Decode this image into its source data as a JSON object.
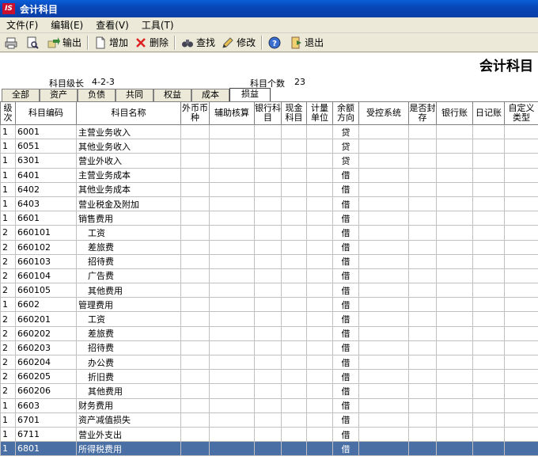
{
  "window": {
    "title": "会计科目",
    "logo_text": "IS"
  },
  "menu": [
    "文件(F)",
    "编辑(E)",
    "查看(V)",
    "工具(T)"
  ],
  "toolbar": {
    "export": "输出",
    "add": "增加",
    "delete": "删除",
    "find": "查找",
    "modify": "修改",
    "exit": "退出"
  },
  "page": {
    "heading": "会计科目",
    "level_label": "科目级长",
    "level_value": "4-2-3",
    "count_label": "科目个数",
    "count_value": "23"
  },
  "tabs": [
    "全部",
    "资产",
    "负债",
    "共同",
    "权益",
    "成本",
    "损益"
  ],
  "active_tab": "损益",
  "columns": [
    "级次",
    "科目编码",
    "科目名称",
    "外币币种",
    "辅助核算",
    "银行科目",
    "现金科目",
    "计量单位",
    "余额方向",
    "受控系统",
    "是否封存",
    "银行账",
    "日记账",
    "自定义类型"
  ],
  "rows": [
    {
      "level": "1",
      "code": "6001",
      "name": "主营业务收入",
      "dir": "贷"
    },
    {
      "level": "1",
      "code": "6051",
      "name": "其他业务收入",
      "dir": "贷"
    },
    {
      "level": "1",
      "code": "6301",
      "name": "营业外收入",
      "dir": "贷"
    },
    {
      "level": "1",
      "code": "6401",
      "name": "主营业务成本",
      "dir": "借"
    },
    {
      "level": "1",
      "code": "6402",
      "name": "其他业务成本",
      "dir": "借"
    },
    {
      "level": "1",
      "code": "6403",
      "name": "营业税金及附加",
      "dir": "借"
    },
    {
      "level": "1",
      "code": "6601",
      "name": "销售费用",
      "dir": "借"
    },
    {
      "level": "2",
      "code": "660101",
      "name": "工资",
      "dir": "借"
    },
    {
      "level": "2",
      "code": "660102",
      "name": "差旅费",
      "dir": "借"
    },
    {
      "level": "2",
      "code": "660103",
      "name": "招待费",
      "dir": "借"
    },
    {
      "level": "2",
      "code": "660104",
      "name": "广告费",
      "dir": "借"
    },
    {
      "level": "2",
      "code": "660105",
      "name": "其他费用",
      "dir": "借"
    },
    {
      "level": "1",
      "code": "6602",
      "name": "管理费用",
      "dir": "借"
    },
    {
      "level": "2",
      "code": "660201",
      "name": "工资",
      "dir": "借"
    },
    {
      "level": "2",
      "code": "660202",
      "name": "差旅费",
      "dir": "借"
    },
    {
      "level": "2",
      "code": "660203",
      "name": "招待费",
      "dir": "借"
    },
    {
      "level": "2",
      "code": "660204",
      "name": "办公费",
      "dir": "借"
    },
    {
      "level": "2",
      "code": "660205",
      "name": "折旧费",
      "dir": "借"
    },
    {
      "level": "2",
      "code": "660206",
      "name": "其他费用",
      "dir": "借"
    },
    {
      "level": "1",
      "code": "6603",
      "name": "财务费用",
      "dir": "借"
    },
    {
      "level": "1",
      "code": "6701",
      "name": "资产减值损失",
      "dir": "借"
    },
    {
      "level": "1",
      "code": "6711",
      "name": "营业外支出",
      "dir": "借"
    },
    {
      "level": "1",
      "code": "6801",
      "name": "所得税费用",
      "dir": "借"
    }
  ],
  "selected_row": 22,
  "colors": {
    "titlebar": "#0a4fc8",
    "selected_row": "#4a6fa5",
    "logo": "#c8102e"
  }
}
